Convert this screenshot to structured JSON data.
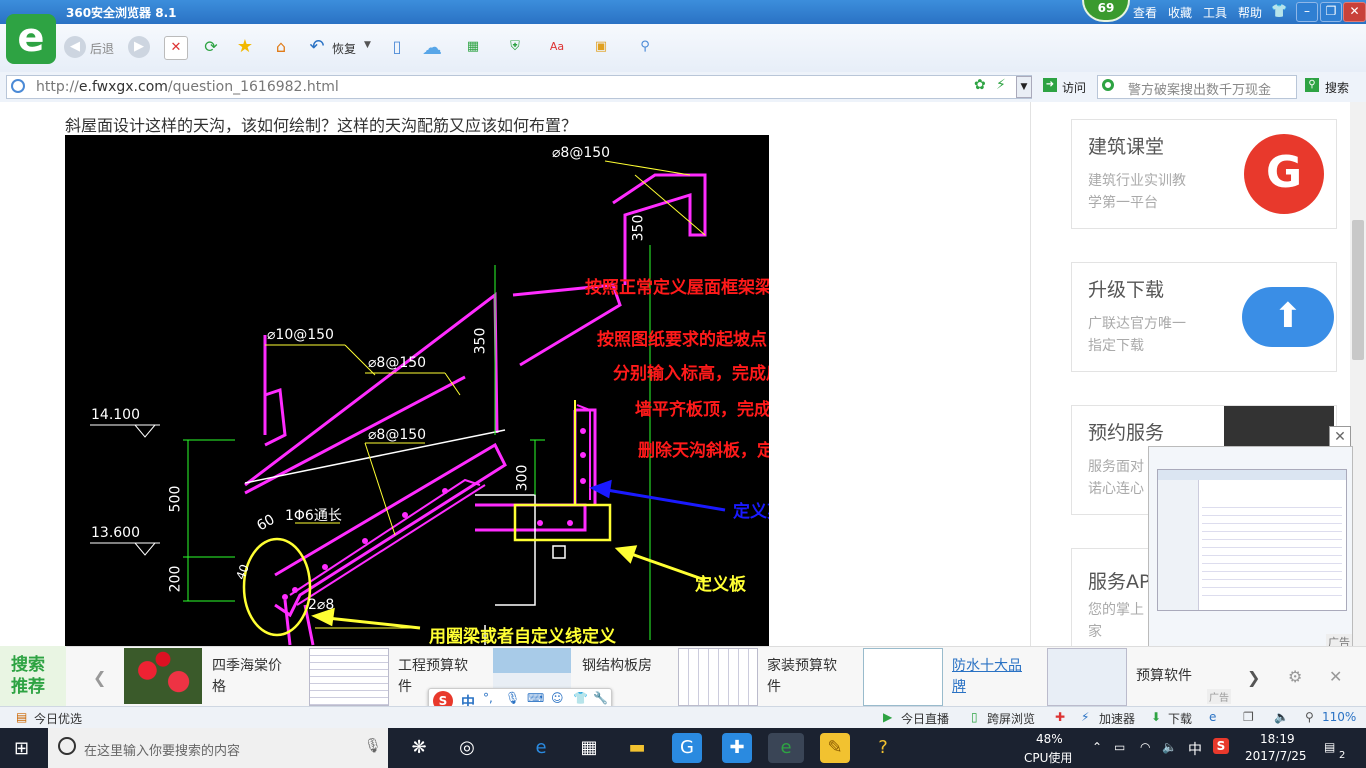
{
  "browser": {
    "title": "360安全浏览器 8.1",
    "badge": "69",
    "menu": [
      "查看",
      "收藏",
      "工具",
      "帮助"
    ],
    "toolbar": {
      "back": "后退",
      "restore": "恢复"
    },
    "url_host": "e.fwxgx.com",
    "url_prefix": "http://",
    "url_path": "/question_1616982.html",
    "visit": "访问",
    "search_placeholder": "警方破案搜出数千万现金",
    "search_button": "搜索"
  },
  "question": "斜屋面设计这样的天沟，该如何绘制？这样的天沟配筋又应该如何布置？",
  "drawing": {
    "rebar_labels": [
      "⌀8@150",
      "⌀10@150",
      "⌀8@150",
      "⌀8@150",
      "1Φ6通长",
      "2⌀8"
    ],
    "dims": [
      "350",
      "350",
      "300",
      "500",
      "200",
      "60",
      "40"
    ],
    "levels": [
      "14.100",
      "13.600"
    ],
    "annotations": {
      "line1": "按照正常定义屋面框架梁，框架柱，墙，板 ，在板的界面",
      "line2": "按照图纸要求的起坡点，分割板，然后使用三点定义斜板功能",
      "line3": "分别输入标高，完成后，使用平齐板顶功能，使框架梁 框架柱",
      "line4": "墙平齐板顶，完成后在板的界面再次按照天沟的位置分割板",
      "line5": "删除天沟斜板，定义剪力墙定义平板绘制。",
      "shear_wall": "定义剪力墙注意 标高",
      "slab": "定义板",
      "ring_beam": "用圈梁或者自定义线定义"
    }
  },
  "sidebar": {
    "cards": [
      {
        "title": "建筑课堂",
        "sub1": "建筑行业实训教",
        "sub2": "学第一平台"
      },
      {
        "title": "升级下载",
        "sub1": "广联达官方唯一",
        "sub2": "指定下载"
      },
      {
        "title": "预约服务",
        "sub1": "服务面对",
        "sub2": "诺心连心"
      },
      {
        "title": "服务AP",
        "sub1": "您的掌上",
        "sub2": "家"
      }
    ],
    "ad_label": "广告"
  },
  "recommend": {
    "tag": "搜索推荐",
    "items": [
      {
        "label": "四季海棠价格"
      },
      {
        "label": "工程预算软件"
      },
      {
        "label": "钢结构板房"
      },
      {
        "label": "家装预算软件"
      },
      {
        "label": "防水十大品牌"
      },
      {
        "label": "预算软件"
      }
    ],
    "ad": "广告"
  },
  "statusbar": {
    "left": "今日优选",
    "items": [
      "今日直播",
      "跨屏浏览",
      "加速器",
      "下载"
    ],
    "zoom": "110%"
  },
  "taskbar": {
    "search_placeholder": "在这里输入你要搜索的内容",
    "cpu_pct": "48%",
    "cpu_label": "CPU使用",
    "ime": "中",
    "time": "18:19",
    "date": "2017/7/25",
    "notify": "2"
  },
  "ime_bar": {
    "mode": "中"
  },
  "colors": {
    "accent": "#2ea343",
    "titlebar": "#2a72c4",
    "taskbar": "#1b2230"
  }
}
